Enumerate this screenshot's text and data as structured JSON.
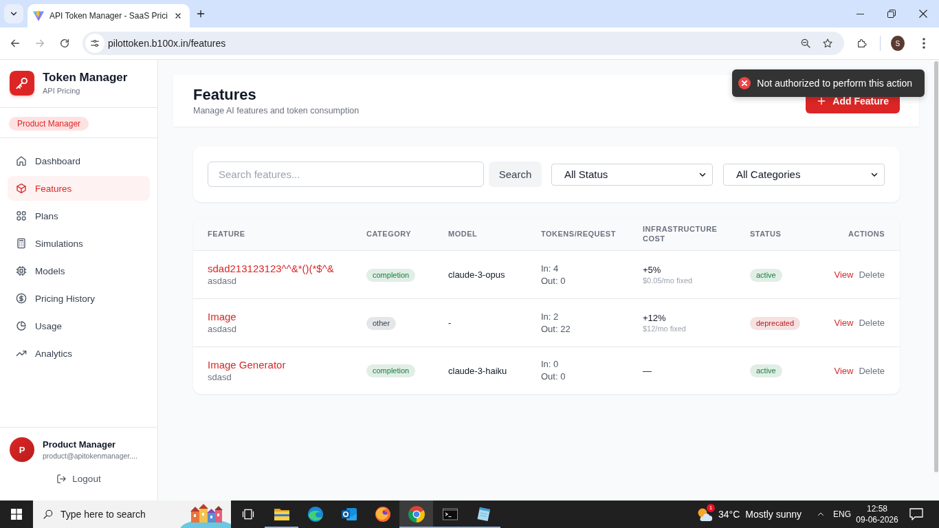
{
  "browser": {
    "tab_title": "API Token Manager - SaaS Prici",
    "url": "pilottoken.b100x.in/features",
    "forward_disabled": true,
    "profile_initial": "S"
  },
  "sidebar": {
    "app_name": "Token Manager",
    "app_subtitle": "API Pricing",
    "role": "Product Manager",
    "nav": [
      {
        "label": "Dashboard",
        "selected": false
      },
      {
        "label": "Features",
        "selected": true
      },
      {
        "label": "Plans",
        "selected": false
      },
      {
        "label": "Simulations",
        "selected": false
      },
      {
        "label": "Models",
        "selected": false
      },
      {
        "label": "Pricing History",
        "selected": false
      },
      {
        "label": "Usage",
        "selected": false
      },
      {
        "label": "Analytics",
        "selected": false
      }
    ],
    "user": {
      "initial": "P",
      "name": "Product Manager",
      "email": "product@apitokenmanager...."
    },
    "logout": "Logout"
  },
  "header": {
    "title": "Features",
    "subtitle": "Manage AI features and token consumption",
    "add_button": "Add Feature"
  },
  "toast": {
    "message": "Not authorized to perform this action"
  },
  "filters": {
    "search_placeholder": "Search features...",
    "search_button": "Search",
    "status": "All Status",
    "category": "All Categories"
  },
  "table": {
    "columns": [
      "FEATURE",
      "CATEGORY",
      "MODEL",
      "TOKENS/REQUEST",
      "INFRASTRUCTURE COST",
      "STATUS",
      "ACTIONS"
    ],
    "rows": [
      {
        "name": "sdad213123123^^&*()(*$^&",
        "description": "asdasd",
        "category": {
          "label": "completion",
          "color": "#15803d"
        },
        "model": "claude-3-opus",
        "tokens_in": "In: 4",
        "tokens_out": "Out: 0",
        "cost": {
          "value": "+5%",
          "note": "$0.05/mo fixed"
        },
        "status": {
          "label": "active",
          "color": "#15803d"
        },
        "actions": [
          {
            "label": "View",
            "kind": "view"
          },
          {
            "label": "Delete",
            "kind": "delete"
          }
        ]
      },
      {
        "name": "Image",
        "description": "asdasd",
        "category": {
          "label": "other",
          "color": "#374151"
        },
        "model": "-",
        "tokens_in": "In: 2",
        "tokens_out": "Out: 22",
        "cost": {
          "value": "+12%",
          "note": "$12/mo fixed"
        },
        "status": {
          "label": "deprecated",
          "color": "#b91c1c"
        },
        "actions": [
          {
            "label": "View",
            "kind": "view"
          },
          {
            "label": "Delete",
            "kind": "delete"
          }
        ]
      },
      {
        "name": "Image Generator",
        "description": "sdasd",
        "category": {
          "label": "completion",
          "color": "#15803d"
        },
        "model": "claude-3-haiku",
        "tokens_in": "In: 0",
        "tokens_out": "Out: 0",
        "cost": {
          "value": "—"
        },
        "status": {
          "label": "active",
          "color": "#15803d"
        },
        "actions": [
          {
            "label": "View",
            "kind": "view"
          },
          {
            "label": "Delete",
            "kind": "delete"
          }
        ]
      }
    ]
  },
  "taskbar": {
    "search_placeholder": "Type here to search",
    "apps": [
      {
        "selected": false,
        "running": false
      },
      {
        "selected": false,
        "running": true
      },
      {
        "selected": false,
        "running": false
      },
      {
        "selected": false,
        "running": false
      },
      {
        "selected": false,
        "running": false
      },
      {
        "selected": true,
        "running": true
      },
      {
        "selected": false,
        "running": true
      },
      {
        "selected": false,
        "running": true
      }
    ],
    "weather": {
      "alert_count": "1",
      "temperature": "34°C",
      "condition": "Mostly sunny"
    },
    "language": "ENG",
    "time": "12:58",
    "date": "09-06-2026"
  }
}
